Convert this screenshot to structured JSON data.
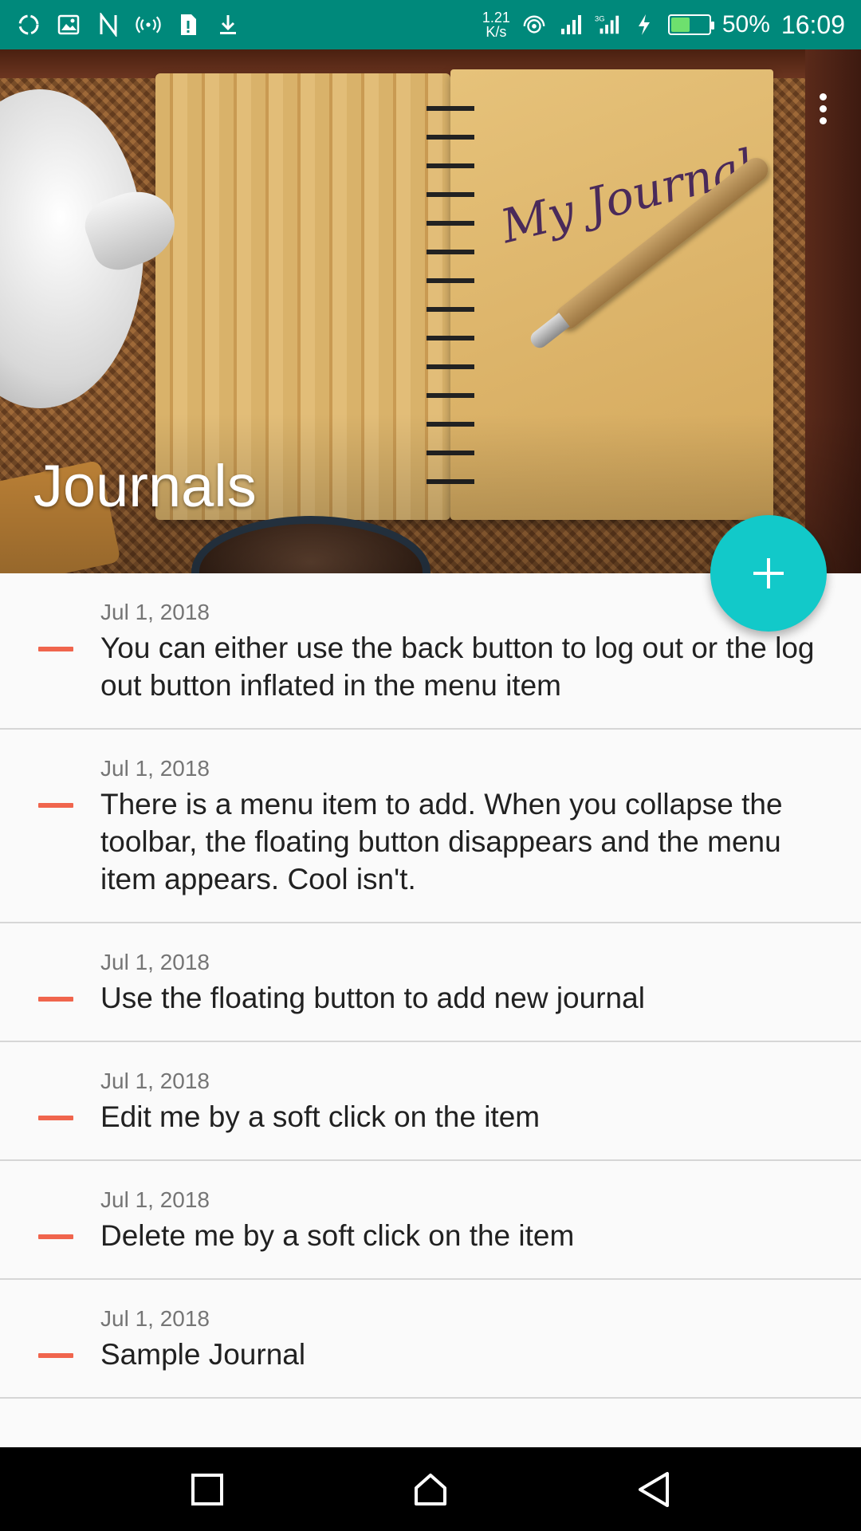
{
  "status_bar": {
    "net_speed_value": "1.21",
    "net_speed_unit": "K/s",
    "battery_percent": "50%",
    "battery_level": 0.5,
    "time": "16:09",
    "left_icons": [
      "sync-icon",
      "image-icon",
      "n-icon",
      "hotspot-icon",
      "sim-alert-icon",
      "download-icon"
    ],
    "right_icons": [
      "wifi-icon",
      "signal-icon",
      "signal-3g-icon",
      "charging-icon",
      "battery-icon"
    ]
  },
  "header": {
    "title": "Journals",
    "menu_icon": "more-vert-icon"
  },
  "fab": {
    "icon": "plus-icon",
    "color": "#12c9c9"
  },
  "colors": {
    "status_bar": "#00897b",
    "accent_dash": "#f0654d"
  },
  "journals": [
    {
      "date": "Jul 1, 2018",
      "text": "You can either use the back button to log out or the log out button inflated in the menu item"
    },
    {
      "date": "Jul 1, 2018",
      "text": "There is a menu item to add. When you collapse the toolbar, the floating button disappears and the menu item appears. Cool isn't."
    },
    {
      "date": "Jul 1, 2018",
      "text": "Use the floating button to add new journal"
    },
    {
      "date": "Jul 1, 2018",
      "text": "Edit me by a soft click on the item"
    },
    {
      "date": "Jul 1, 2018",
      "text": "Delete me by a soft click on the item"
    },
    {
      "date": "Jul 1, 2018",
      "text": "Sample Journal"
    }
  ],
  "nav_bar": {
    "buttons": [
      "recents-icon",
      "home-icon",
      "back-icon"
    ]
  }
}
